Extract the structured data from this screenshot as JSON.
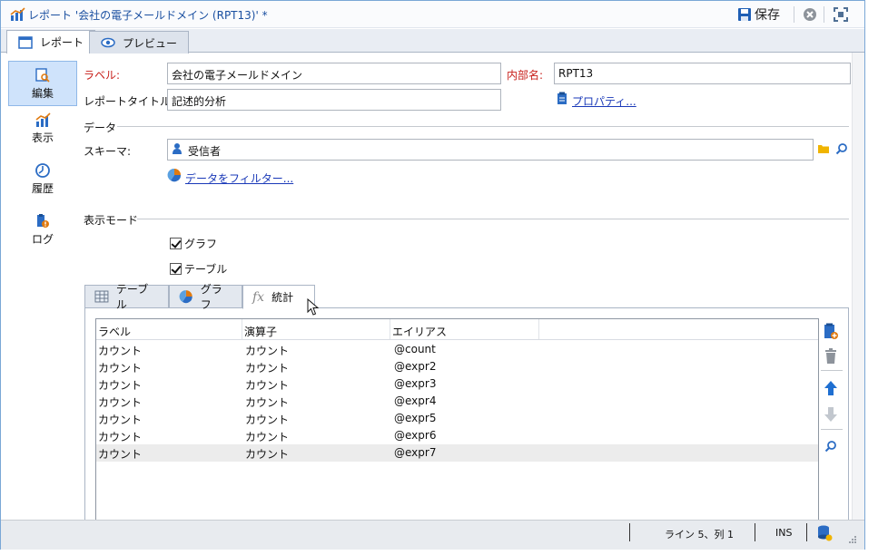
{
  "window": {
    "title": "レポート '会社の電子メールドメイン (RPT13)' *",
    "save_label": "保存"
  },
  "tabs": [
    {
      "label": "レポート",
      "active": true
    },
    {
      "label": "プレビュー",
      "active": false
    }
  ],
  "sidebar": {
    "items": [
      {
        "label": "編集",
        "icon": "edit-icon",
        "active": true
      },
      {
        "label": "表示",
        "icon": "chart-icon",
        "active": false
      },
      {
        "label": "履歴",
        "icon": "history-icon",
        "active": false
      },
      {
        "label": "ログ",
        "icon": "log-icon",
        "active": false
      }
    ]
  },
  "form": {
    "label_caption": "ラベル:",
    "label_value": "会社の電子メールドメイン",
    "internal_name_caption": "内部名:",
    "internal_name_value": "RPT13",
    "report_title_caption": "レポートタイトル:",
    "report_title_value": "記述的分析",
    "properties_link": "プロパティ..."
  },
  "data_group": {
    "title": "データ",
    "schema_caption": "スキーマ:",
    "schema_value": "受信者",
    "filter_link": "データをフィルター..."
  },
  "display_mode": {
    "title": "表示モード",
    "graph_label": "グラフ",
    "graph_checked": true,
    "table_label": "テーブル",
    "table_checked": true
  },
  "subtabs": [
    {
      "label": "テーブル",
      "active": false
    },
    {
      "label": "グラフ",
      "active": false
    },
    {
      "label": "統計",
      "active": true
    }
  ],
  "subtab_fx_glyph": "fx",
  "grid": {
    "columns": [
      "ラベル",
      "演算子",
      "エイリアス"
    ],
    "rows": [
      [
        "カウント",
        "カウント",
        "@count"
      ],
      [
        "カウント",
        "カウント",
        "@expr2"
      ],
      [
        "カウント",
        "カウント",
        "@expr3"
      ],
      [
        "カウント",
        "カウント",
        "@expr4"
      ],
      [
        "カウント",
        "カウント",
        "@expr5"
      ],
      [
        "カウント",
        "カウント",
        "@expr6"
      ],
      [
        "カウント",
        "カウント",
        "@expr7"
      ]
    ],
    "selected_row": 6
  },
  "status": {
    "position": "ライン 5、列 1",
    "mode": "INS"
  },
  "colors": {
    "accent": "#1a4fa0",
    "required": "#c8201b",
    "link": "#1a39b8",
    "nav_active": "#cfe3fb"
  }
}
